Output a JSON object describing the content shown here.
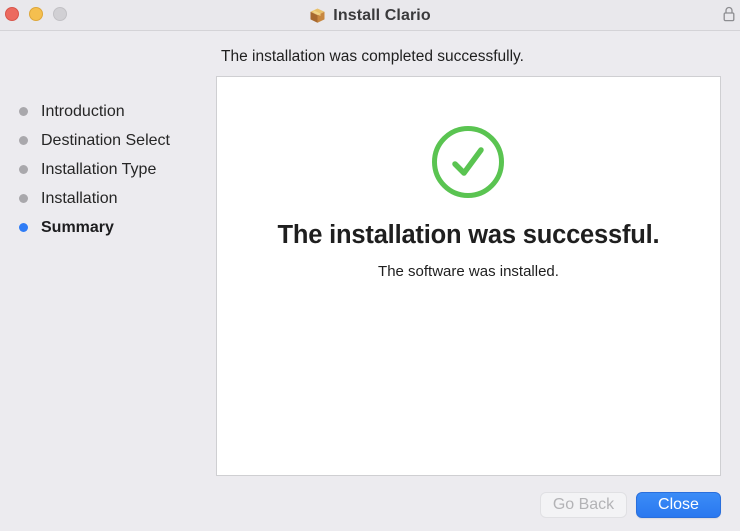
{
  "window": {
    "title": "Install Clario",
    "title_icon": "package-icon",
    "lock_icon": "lock-icon",
    "traffic_lights": [
      {
        "name": "close",
        "color": "#ec6a5f"
      },
      {
        "name": "minimize",
        "color": "#f5bf4f"
      },
      {
        "name": "zoom",
        "color": "#d1d0d4"
      }
    ]
  },
  "header": {
    "text": "The installation was completed successfully."
  },
  "sidebar": {
    "steps": [
      {
        "label": "Introduction",
        "active": false
      },
      {
        "label": "Destination Select",
        "active": false
      },
      {
        "label": "Installation Type",
        "active": false
      },
      {
        "label": "Installation",
        "active": false
      },
      {
        "label": "Summary",
        "active": true
      }
    ]
  },
  "content": {
    "icon": "checkmark-circle-icon",
    "icon_color": "#5ac451",
    "title": "The installation was successful.",
    "subtitle": "The software was installed."
  },
  "buttons": {
    "go_back": {
      "label": "Go Back",
      "enabled": false
    },
    "close": {
      "label": "Close",
      "enabled": true
    }
  },
  "colors": {
    "accent": "#2f7cf6",
    "inactive_dot": "#a9a8ac",
    "success": "#5ac451"
  }
}
